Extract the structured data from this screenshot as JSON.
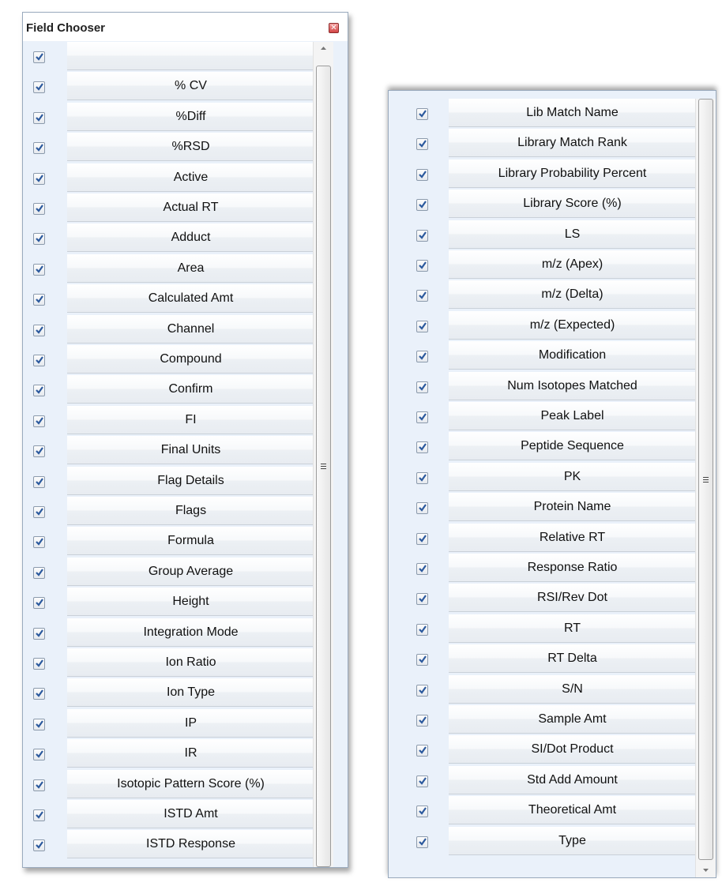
{
  "left_panel": {
    "title": "Field Chooser",
    "close_icon": "close-icon",
    "items": [
      {
        "label": "",
        "checked": true
      },
      {
        "label": "% CV",
        "checked": true
      },
      {
        "label": "%Diff",
        "checked": true
      },
      {
        "label": "%RSD",
        "checked": true
      },
      {
        "label": "Active",
        "checked": true
      },
      {
        "label": "Actual RT",
        "checked": true
      },
      {
        "label": "Adduct",
        "checked": true
      },
      {
        "label": "Area",
        "checked": true
      },
      {
        "label": "Calculated Amt",
        "checked": true
      },
      {
        "label": "Channel",
        "checked": true
      },
      {
        "label": "Compound",
        "checked": true
      },
      {
        "label": "Confirm",
        "checked": true
      },
      {
        "label": "FI",
        "checked": true
      },
      {
        "label": "Final Units",
        "checked": true
      },
      {
        "label": "Flag Details",
        "checked": true
      },
      {
        "label": "Flags",
        "checked": true
      },
      {
        "label": "Formula",
        "checked": true
      },
      {
        "label": "Group Average",
        "checked": true
      },
      {
        "label": "Height",
        "checked": true
      },
      {
        "label": "Integration Mode",
        "checked": true
      },
      {
        "label": "Ion Ratio",
        "checked": true
      },
      {
        "label": "Ion Type",
        "checked": true
      },
      {
        "label": "IP",
        "checked": true
      },
      {
        "label": "IR",
        "checked": true
      },
      {
        "label": "Isotopic Pattern Score (%)",
        "checked": true
      },
      {
        "label": "ISTD Amt",
        "checked": true
      },
      {
        "label": "ISTD Response",
        "checked": true
      }
    ]
  },
  "right_panel": {
    "items": [
      {
        "label": "Lib Match Name",
        "checked": true
      },
      {
        "label": "Library Match Rank",
        "checked": true
      },
      {
        "label": "Library Probability Percent",
        "checked": true
      },
      {
        "label": "Library Score (%)",
        "checked": true
      },
      {
        "label": "LS",
        "checked": true
      },
      {
        "label": "m/z (Apex)",
        "checked": true
      },
      {
        "label": "m/z (Delta)",
        "checked": true
      },
      {
        "label": "m/z (Expected)",
        "checked": true
      },
      {
        "label": "Modification",
        "checked": true
      },
      {
        "label": "Num Isotopes Matched",
        "checked": true
      },
      {
        "label": "Peak Label",
        "checked": true
      },
      {
        "label": "Peptide Sequence",
        "checked": true
      },
      {
        "label": "PK",
        "checked": true
      },
      {
        "label": "Protein Name",
        "checked": true
      },
      {
        "label": "Relative RT",
        "checked": true
      },
      {
        "label": "Response Ratio",
        "checked": true
      },
      {
        "label": "RSI/Rev Dot",
        "checked": true
      },
      {
        "label": "RT",
        "checked": true
      },
      {
        "label": "RT Delta",
        "checked": true
      },
      {
        "label": "S/N",
        "checked": true
      },
      {
        "label": "Sample Amt",
        "checked": true
      },
      {
        "label": "SI/Dot Product",
        "checked": true
      },
      {
        "label": "Std Add Amount",
        "checked": true
      },
      {
        "label": "Theoretical Amt",
        "checked": true
      },
      {
        "label": "Type",
        "checked": true
      }
    ]
  },
  "colors": {
    "panel_bg": "#eaf1fa",
    "check_mark": "#2c5a9e",
    "close_button": "#d24545"
  }
}
